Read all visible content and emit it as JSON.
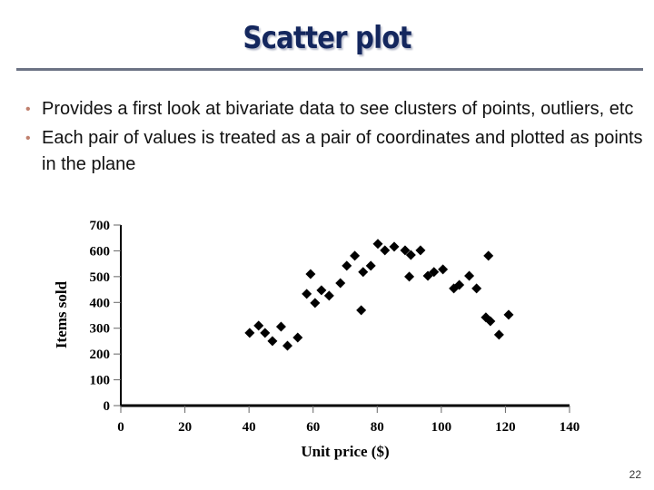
{
  "slide": {
    "title": "Scatter plot",
    "bullets": [
      "Provides a first look at bivariate data to see clusters of points, outliers, etc",
      "Each pair of values is treated as a pair of coordinates and plotted as points in the plane"
    ],
    "page_number": "22",
    "title_color": "#14275e",
    "bullet_color": "#c0806e"
  },
  "chart_data": {
    "type": "scatter",
    "title": "",
    "xlabel": "Unit price ($)",
    "ylabel": "Items sold",
    "xlim": [
      0,
      140
    ],
    "ylim": [
      0,
      700
    ],
    "xticks": [
      0,
      20,
      40,
      60,
      80,
      100,
      120,
      140
    ],
    "yticks": [
      0,
      100,
      200,
      300,
      400,
      500,
      600,
      700
    ],
    "grid": false,
    "marker": "diamond",
    "marker_color": "#000000",
    "points": [
      [
        40.2,
        282
      ],
      [
        43,
        310
      ],
      [
        45,
        282
      ],
      [
        47.3,
        250
      ],
      [
        50,
        306
      ],
      [
        52,
        232
      ],
      [
        55.2,
        264
      ],
      [
        58,
        433
      ],
      [
        59.2,
        510
      ],
      [
        60.6,
        398
      ],
      [
        62.6,
        447
      ],
      [
        65,
        426
      ],
      [
        68.5,
        475
      ],
      [
        70.5,
        542
      ],
      [
        73,
        581
      ],
      [
        75,
        370
      ],
      [
        75.6,
        518
      ],
      [
        78,
        542
      ],
      [
        80.2,
        627
      ],
      [
        82.4,
        602
      ],
      [
        85.3,
        616
      ],
      [
        88.7,
        602
      ],
      [
        90.5,
        584
      ],
      [
        90,
        500
      ],
      [
        93.5,
        602
      ],
      [
        95.8,
        503
      ],
      [
        97.7,
        518
      ],
      [
        100.5,
        528
      ],
      [
        103.9,
        454
      ],
      [
        105.6,
        468
      ],
      [
        108.7,
        503
      ],
      [
        111,
        454
      ],
      [
        114.7,
        581
      ],
      [
        113.9,
        342
      ],
      [
        115.3,
        327
      ],
      [
        118,
        275
      ],
      [
        121,
        352
      ]
    ]
  }
}
